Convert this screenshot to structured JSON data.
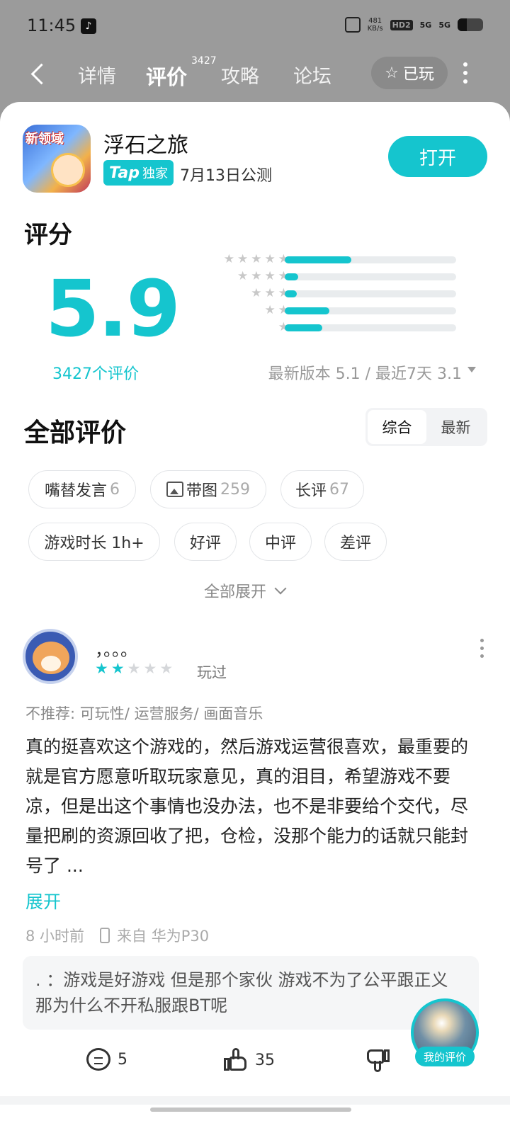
{
  "status": {
    "time": "11:45",
    "net_speed": "481",
    "net_unit": "KB/s",
    "hd": "HD2",
    "sig1": "5G",
    "sig2": "5G",
    "battery_pct": 0.35
  },
  "nav": {
    "tabs": [
      "详情",
      "评价",
      "攻略",
      "论坛"
    ],
    "review_badge": "3427",
    "played_label": "已玩"
  },
  "app": {
    "icon_tag": "新领域",
    "title": "浮石之旅",
    "badge_tap": "Tap",
    "badge_excl": "独家",
    "launch": "7月13日公测",
    "open_label": "打开"
  },
  "rating": {
    "heading": "评分",
    "score": "5.9",
    "review_count": "3427个评价",
    "distribution": [
      {
        "stars": 5,
        "fraction": 0.39
      },
      {
        "stars": 4,
        "fraction": 0.08
      },
      {
        "stars": 3,
        "fraction": 0.07
      },
      {
        "stars": 2,
        "fraction": 0.26
      },
      {
        "stars": 1,
        "fraction": 0.22
      }
    ],
    "version_text": "最新版本 5.1 / 最近7天 3.1"
  },
  "reviews": {
    "heading": "全部评价",
    "sort": [
      "综合",
      "最新"
    ],
    "chips": [
      {
        "label": "嘴替发言",
        "count": "6"
      },
      {
        "label": "带图",
        "count": "259"
      },
      {
        "label": "长评",
        "count": "67"
      },
      {
        "label": "游戏时长  1h+",
        "count": ""
      },
      {
        "label": "好评",
        "count": ""
      },
      {
        "label": "中评",
        "count": ""
      },
      {
        "label": "差评",
        "count": ""
      }
    ],
    "expand_all": "全部展开"
  },
  "review": {
    "user": "，。。。",
    "stars": 2,
    "played": "玩过",
    "not_recommend": "不推荐: 可玩性/  运营服务/  画面音乐",
    "text": "真的挺喜欢这个游戏的，然后游戏运营很喜欢，最重要的就是官方愿意听取玩家意见，真的泪目，希望游戏不要凉，但是出这个事情也没办法，也不是非要给个交代，尽量把刷的资源回收了把，仓检，没那个能力的话就只能封号了  ...",
    "expand": "展开",
    "time": "8  小时前",
    "from": "来自  华为P30",
    "reply": ".        ：游戏是好游戏  但是那个家伙  游戏不为了公平跟正义  那为什么不开私服跟BT呢",
    "comments": "5",
    "likes": "35"
  },
  "my_review_label": "我的评价",
  "colors": {
    "accent": "#15c5ce"
  }
}
